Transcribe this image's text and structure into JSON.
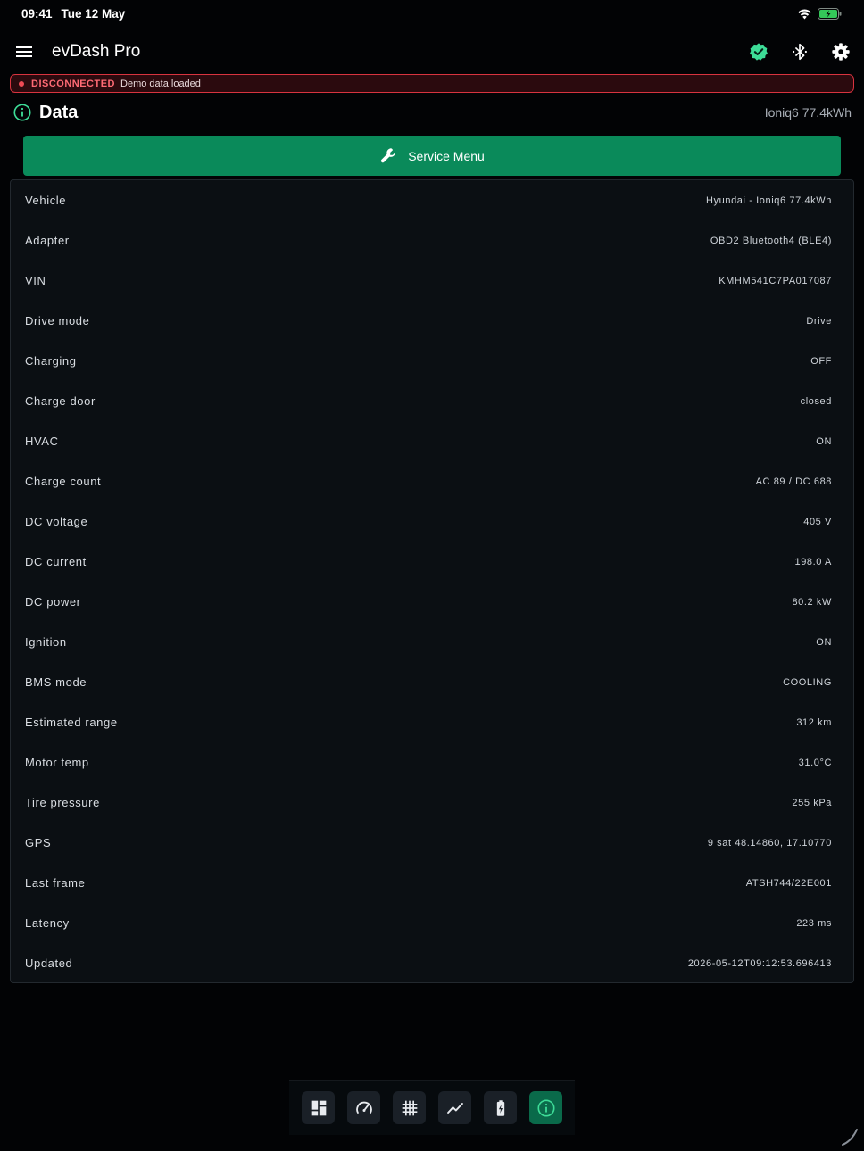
{
  "status_bar": {
    "time": "09:41",
    "date": "Tue 12 May"
  },
  "app": {
    "title": "evDash Pro"
  },
  "header_icons": [
    "menu-icon",
    "verified-badge-icon",
    "bluetooth-icon",
    "gear-icon"
  ],
  "connection": {
    "status": "DISCONNECTED",
    "note": "Demo data loaded",
    "color": "#d8333f"
  },
  "section": {
    "title": "Data",
    "vehicle": "Ioniq6 77.4kWh"
  },
  "service_button": {
    "label": "Service Menu",
    "color": "#0a8a5a"
  },
  "rows": [
    {
      "label": "Vehicle",
      "value": "Hyundai - Ioniq6 77.4kWh"
    },
    {
      "label": "Adapter",
      "value": "OBD2 Bluetooth4 (BLE4)"
    },
    {
      "label": "VIN",
      "value": "KMHM541C7PA017087"
    },
    {
      "label": "Drive mode",
      "value": "Drive"
    },
    {
      "label": "Charging",
      "value": "OFF"
    },
    {
      "label": "Charge door",
      "value": "closed"
    },
    {
      "label": "HVAC",
      "value": "ON"
    },
    {
      "label": "Charge count",
      "value": "AC 89 / DC 688"
    },
    {
      "label": "DC voltage",
      "value": "405 V"
    },
    {
      "label": "DC current",
      "value": "198.0 A"
    },
    {
      "label": "DC power",
      "value": "80.2 kW"
    },
    {
      "label": "Ignition",
      "value": "ON"
    },
    {
      "label": "BMS mode",
      "value": "COOLING"
    },
    {
      "label": "Estimated range",
      "value": "312 km"
    },
    {
      "label": "Motor temp",
      "value": "31.0°C"
    },
    {
      "label": "Tire pressure",
      "value": "255 kPa"
    },
    {
      "label": "GPS",
      "value": "9 sat 48.14860, 17.10770"
    },
    {
      "label": "Last frame",
      "value": "ATSH744/22E001"
    },
    {
      "label": "Latency",
      "value": "223 ms"
    },
    {
      "label": "Updated",
      "value": "2026-05-12T09:12:53.696413"
    }
  ],
  "nav": [
    {
      "icon": "dashboard-icon",
      "active": false
    },
    {
      "icon": "speedometer-icon",
      "active": false
    },
    {
      "icon": "grid-icon",
      "active": false
    },
    {
      "icon": "chart-line-icon",
      "active": false
    },
    {
      "icon": "battery-charging-icon",
      "active": false
    },
    {
      "icon": "info-icon",
      "active": true
    }
  ],
  "colors": {
    "accent": "#3ddc97",
    "active_nav": "#0a6a4a"
  }
}
